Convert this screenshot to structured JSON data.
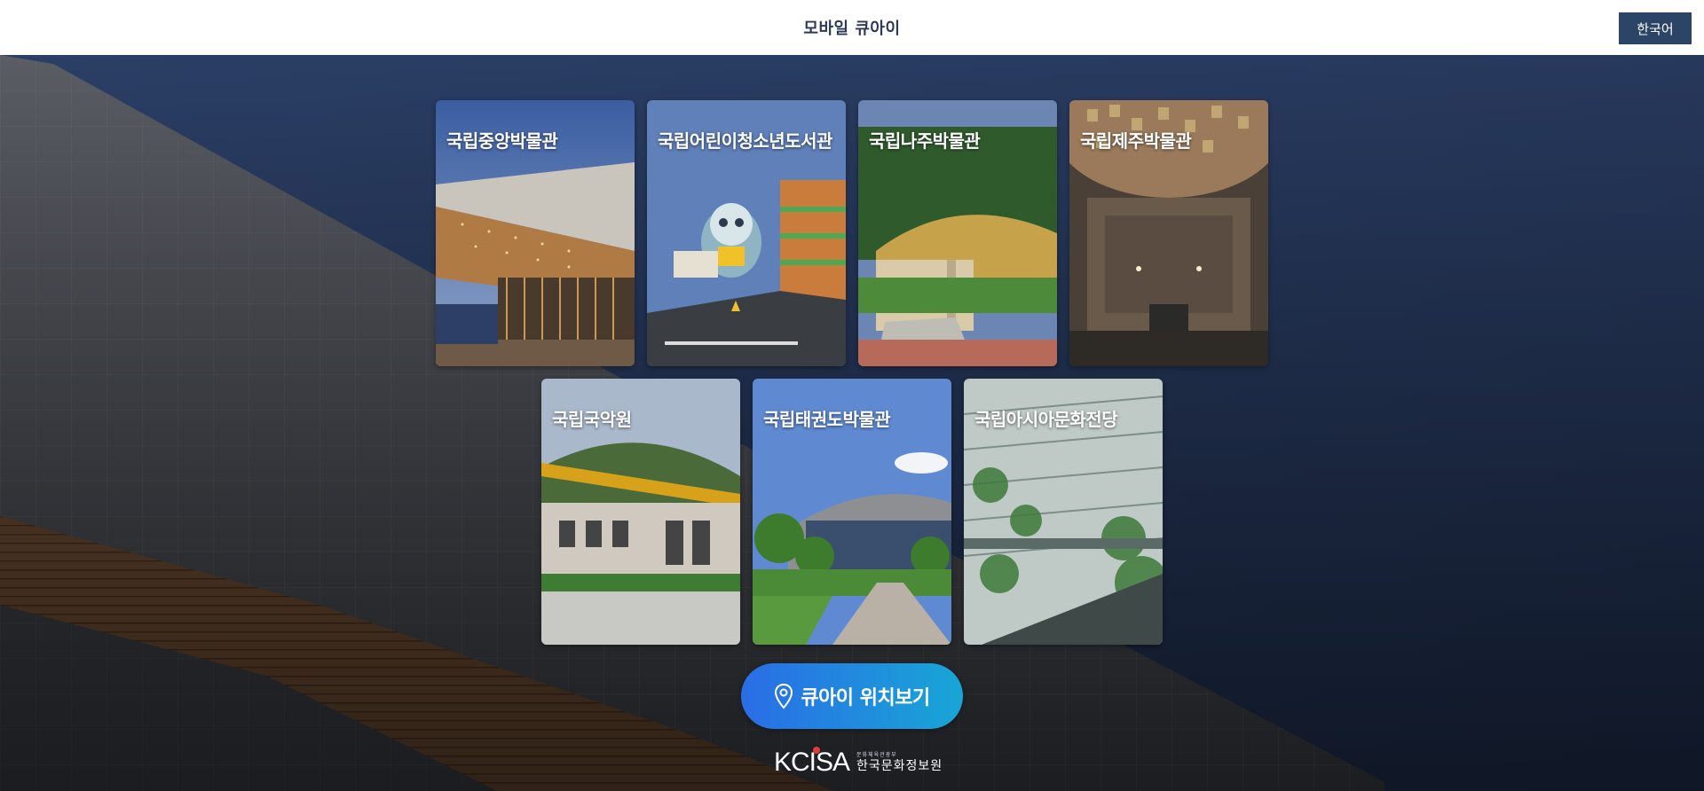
{
  "header": {
    "title": "모바일 큐아이",
    "language_button": "한국어"
  },
  "institutions": [
    {
      "label": "국립중앙박물관",
      "image": "museum-building-photo"
    },
    {
      "label": "국립어린이청소년도서관",
      "image": "library-mascot-photo"
    },
    {
      "label": "국립나주박물관",
      "image": "museum-facade-photo"
    },
    {
      "label": "국립제주박물관",
      "image": "museum-dome-interior-photo"
    },
    {
      "label": "국립국악원",
      "image": "music-center-photo"
    },
    {
      "label": "국립태권도박물관",
      "image": "taekwondo-museum-photo"
    },
    {
      "label": "국립아시아문화전당",
      "image": "culture-center-atrium-photo"
    }
  ],
  "map_button": {
    "label": "큐아이 위치보기",
    "icon": "location-pin-icon"
  },
  "footer": {
    "logo_mark": "KCISA",
    "logo_small": "문화체육관광부",
    "logo_org": "한국문화정보원"
  },
  "colors": {
    "header_bg": "#ffffff",
    "title_text": "#2c3a58",
    "lang_button_bg": "#2c4466",
    "background_navy": "#2a3a5c",
    "map_button_start": "#2a6de6",
    "map_button_end": "#18a6d6"
  }
}
